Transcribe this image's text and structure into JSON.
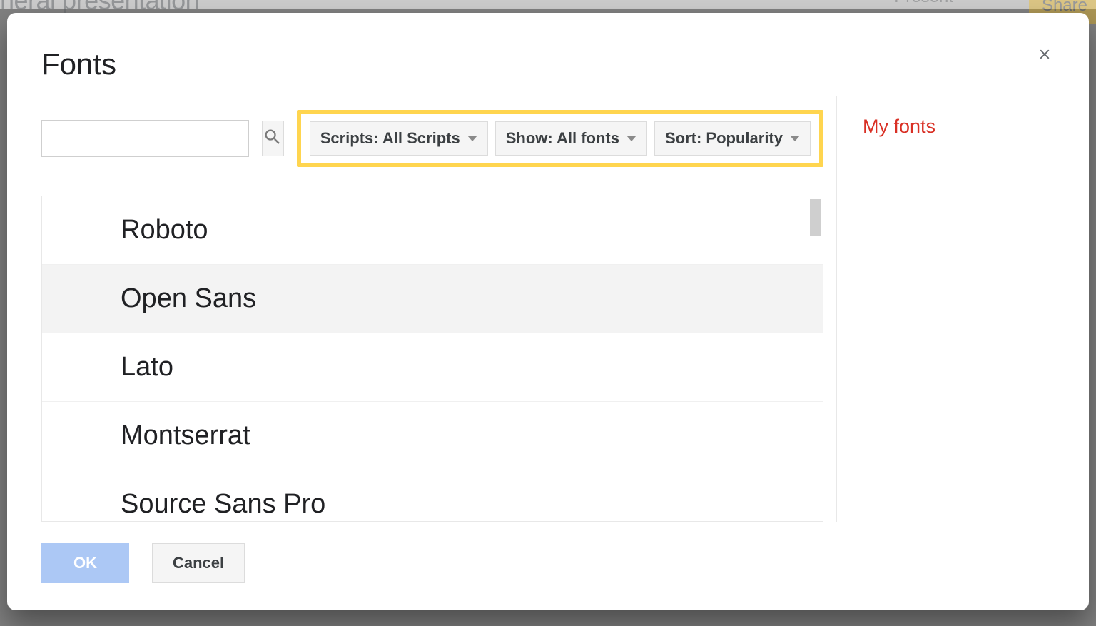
{
  "backdrop": {
    "doc_title_fragment": "neral presentation",
    "present_label": "Present",
    "share_label": "Share"
  },
  "modal": {
    "title": "Fonts",
    "search_placeholder": "",
    "filters": {
      "scripts": "Scripts: All Scripts",
      "show": "Show: All fonts",
      "sort": "Sort: Popularity"
    },
    "font_list": [
      {
        "name": "Roboto",
        "selected": false
      },
      {
        "name": "Open Sans",
        "selected": true
      },
      {
        "name": "Lato",
        "selected": false
      },
      {
        "name": "Montserrat",
        "selected": false
      },
      {
        "name": "Source Sans Pro",
        "selected": false
      }
    ],
    "right_panel": {
      "heading": "My fonts"
    },
    "footer": {
      "ok": "OK",
      "cancel": "Cancel"
    }
  }
}
